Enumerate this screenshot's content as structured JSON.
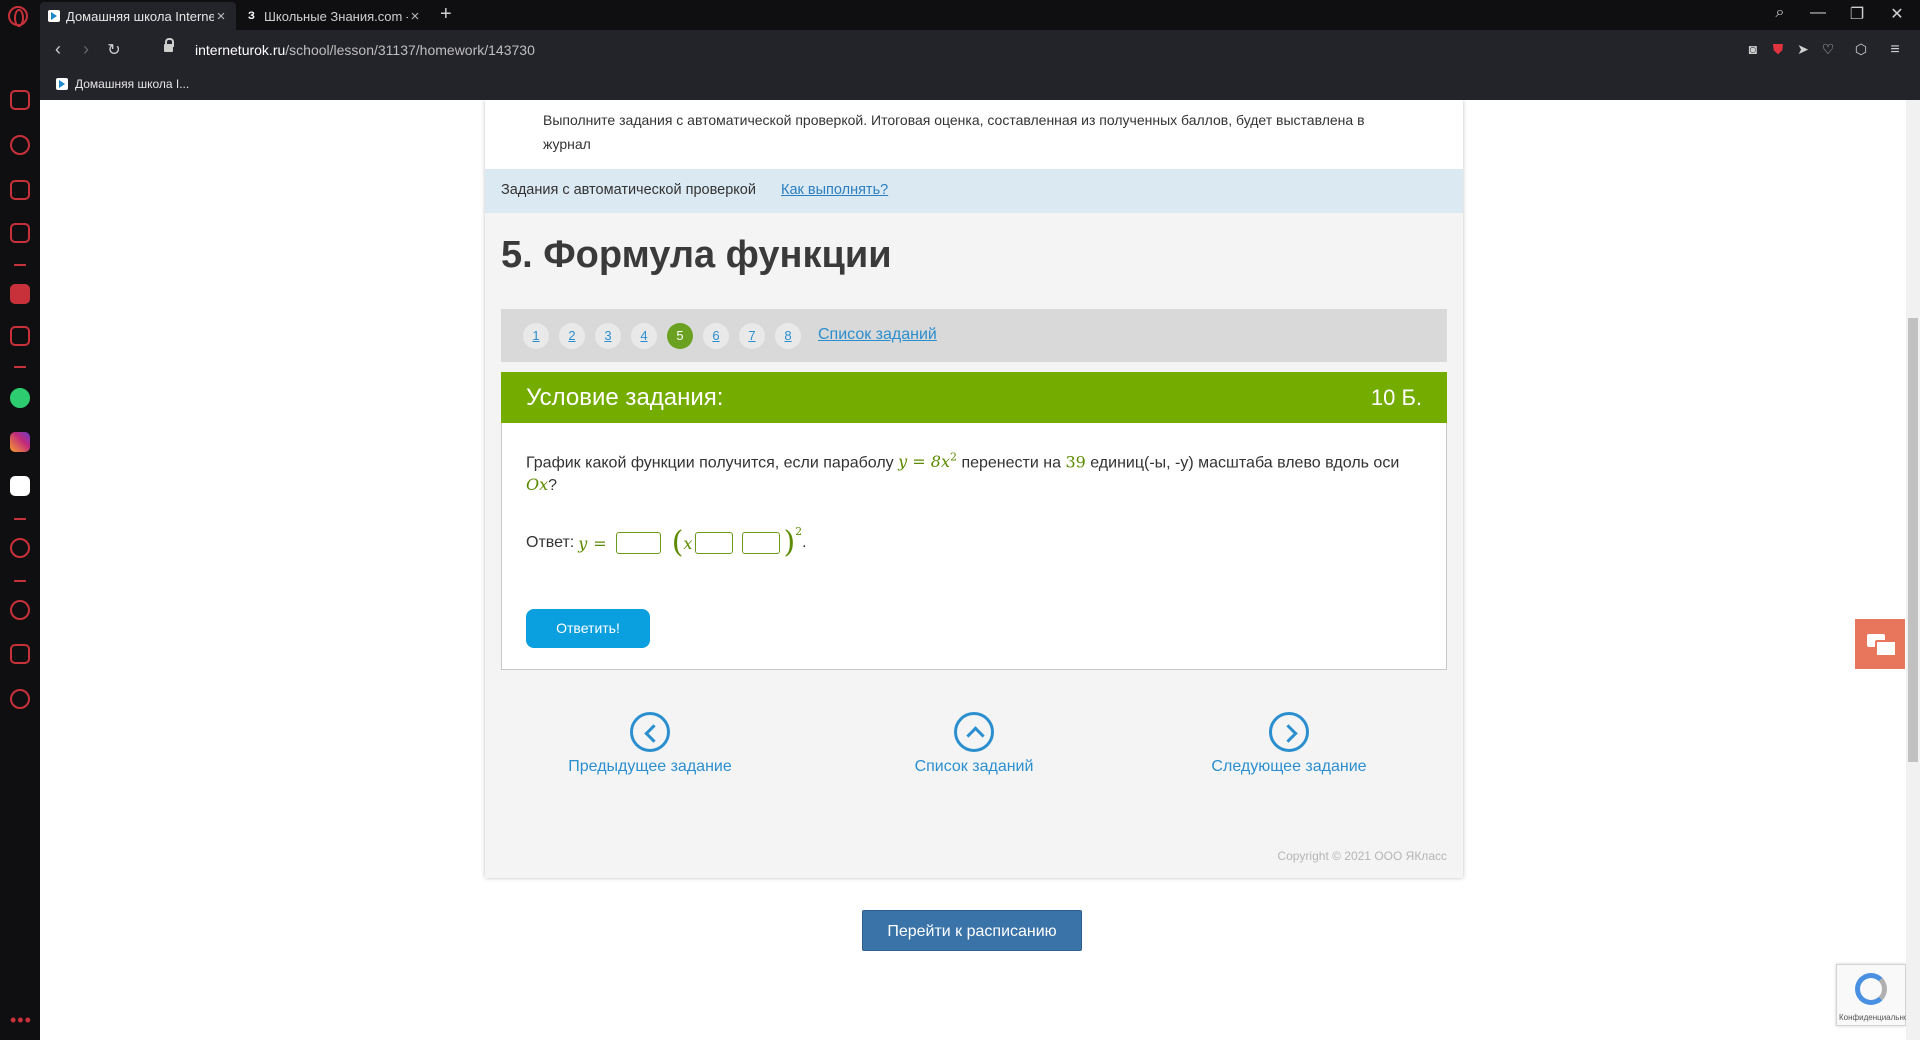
{
  "browser": {
    "tabs": [
      {
        "title": "Домашняя школа Internet",
        "active": true
      },
      {
        "title": "Школьные Знания.com - Р",
        "active": false
      }
    ],
    "url_host": "interneturok.ru",
    "url_path": "/school/lesson/31137/homework/143730",
    "bookmark": "Домашняя школа I...",
    "icons": {
      "new_tab": "+",
      "close": "×",
      "search": "⌕",
      "minimize": "—",
      "restore": "❐",
      "close_window": "✕",
      "back": "‹",
      "forward": "›",
      "reload": "↻",
      "snapshot": "◙",
      "shield": "⛊",
      "send": "➤",
      "heart": "♡",
      "box": "⬡",
      "menu": "≡"
    }
  },
  "intro": {
    "text": "Выполните задания с автоматической проверкой. Итоговая оценка, составленная из полученных баллов, будет выставлена в журнал"
  },
  "auto_check": {
    "label": "Задания с автоматической проверкой",
    "how_link": "Как выполнять?"
  },
  "task": {
    "title": "5. Формула функции",
    "pages": [
      "1",
      "2",
      "3",
      "4",
      "5",
      "6",
      "7",
      "8"
    ],
    "current_page": "5",
    "list_link": "Список заданий"
  },
  "condition": {
    "heading": "Условие задания:",
    "points": "10 Б.",
    "question_part1": "График какой функции получится, если параболу",
    "formula_y": "y",
    "formula_eq": "=",
    "formula_coef": "8",
    "formula_x": "x",
    "formula_exp": "2",
    "question_part2": "перенести на",
    "shift_value": "39",
    "question_part3": "единиц(-ы, -у) масштаба влево вдоль оси",
    "axis": "Ox",
    "question_end": "?",
    "answer_label": "Ответ:",
    "answer_y": "y",
    "answer_eq": "=",
    "answer_x": "x",
    "answer_exp": "2",
    "answer_dot": ".",
    "submit_label": "Ответить!"
  },
  "navigation": {
    "prev": "Предыдущее задание",
    "list": "Список заданий",
    "next": "Следующее задание"
  },
  "copyright": "Copyright © 2021 ООО ЯКласс",
  "schedule_button": "Перейти к расписанию",
  "recaptcha_text": "Конфиденциальность"
}
